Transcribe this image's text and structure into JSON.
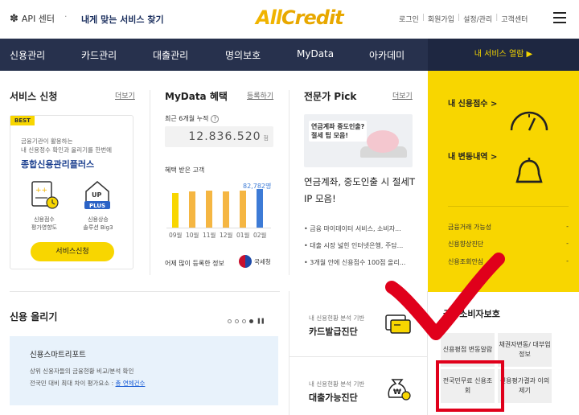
{
  "header": {
    "api_label": "API 센터",
    "find_label": "내게 맞는 서비스 찾기",
    "logo_all": "All",
    "logo_credit": "Credit",
    "util": [
      "로그인",
      "회원가입",
      "설정/관리",
      "고객센터"
    ]
  },
  "nav": {
    "items": [
      "신용관리",
      "카드관리",
      "대출관리",
      "명의보호",
      "MyData",
      "아카데미"
    ],
    "my_service": "내 서비스 열람 ▶"
  },
  "service": {
    "title": "서비스 신청",
    "more": "더보기",
    "badge": "BEST",
    "desc1": "금융기관이 활용하는",
    "desc2": "내 신용정수 확인과 올리기를 한번에",
    "name": "종합신용관리플러스",
    "feat1_cap1": "신용점수",
    "feat1_cap2": "평가영향도",
    "feat2_badge": "UP",
    "feat2_plus": "PLUS",
    "feat2_cap1": "신용상승",
    "feat2_cap2": "솔루션 Big3",
    "button": "서비스신청"
  },
  "mydata": {
    "title": "MyData 혜택",
    "register": "등록하기",
    "sub": "최근 6개월 누적",
    "amount": "12.836.520",
    "unit": "점",
    "chart_label": "혜택 받은 고객",
    "top_value": "82,782명",
    "reg_label": "어제 많이 등록한 정보",
    "nts": "국세청"
  },
  "chart_data": {
    "type": "bar",
    "categories": [
      "09월",
      "10월",
      "11월",
      "12월",
      "01월",
      "02월"
    ],
    "values": [
      0.9,
      0.93,
      0.95,
      0.93,
      0.96,
      1.0
    ],
    "colors": [
      "#f8d600",
      "#f5b642",
      "#f5b642",
      "#f5b642",
      "#f5b642",
      "#3d7bd6"
    ]
  },
  "pick": {
    "title": "전문가 Pick",
    "more": "더보기",
    "img_text1": "연금계좌 중도인출?",
    "img_text2": "절세 팁 모음!",
    "headline": "연금계좌, 중도인출 시 절세T IP 모음!",
    "list": [
      "금융 마이데이터 서비스, 소비자...",
      "대출 시장 넓힌 인터넷은행, 주담...",
      "3개월 안에 신용점수 100점 올리..."
    ]
  },
  "my_panel": {
    "score": "내 신용점수 >",
    "changes": "내 변동내역 >",
    "rows": [
      {
        "label": "금융거래 가능성",
        "val": "-"
      },
      {
        "label": "신용향상진단",
        "val": "-"
      },
      {
        "label": "신용조회안심",
        "val": "-"
      }
    ]
  },
  "rise": {
    "title": "신용 올리기",
    "pause": "❚❚",
    "smart_title": "신용스마트리포트",
    "smart_d1": "상위 신용자들의 금융현황 비교/분석 확인",
    "smart_d2_pre": "전국민 대비 최대 차이 평가요소 : ",
    "smart_d2_link": "총 연체건수"
  },
  "diag": {
    "card_sub": "내 신용현황 분석 기반",
    "card_title": "카드발급진단",
    "loan_sub": "내 신용현황 분석 기반",
    "loan_title": "대출가능진단"
  },
  "protect": {
    "title": "금융소비자보호",
    "cells": [
      "신용평점 변동알람",
      "채권자변동/ 대부업 정보",
      "전국민무료 신용조회",
      "신용평가결과 이의제기"
    ]
  }
}
